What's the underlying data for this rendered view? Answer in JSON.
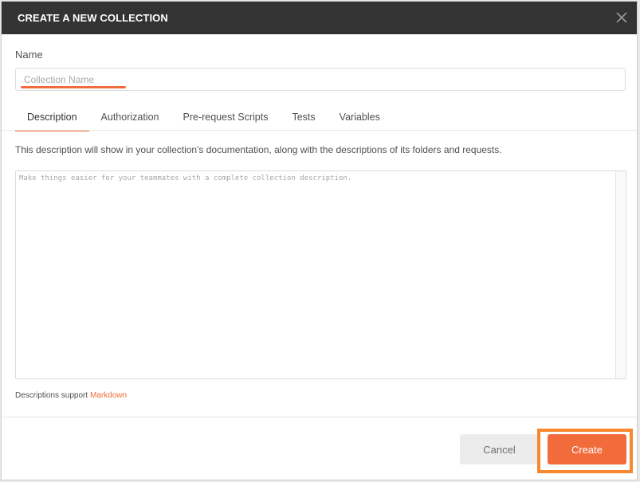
{
  "dialog": {
    "title": "CREATE A NEW COLLECTION"
  },
  "name": {
    "label": "Name",
    "placeholder": "Collection Name",
    "value": ""
  },
  "tabs": [
    {
      "label": "Description",
      "active": true
    },
    {
      "label": "Authorization",
      "active": false
    },
    {
      "label": "Pre-request Scripts",
      "active": false
    },
    {
      "label": "Tests",
      "active": false
    },
    {
      "label": "Variables",
      "active": false
    }
  ],
  "description": {
    "help_text": "This description will show in your collection's documentation, along with the descriptions of its folders and requests.",
    "placeholder": "Make things easier for your teammates with a complete collection description.",
    "markdown_note": "Descriptions support",
    "markdown_link": "Markdown"
  },
  "footer": {
    "cancel_label": "Cancel",
    "create_label": "Create"
  },
  "colors": {
    "accent": "#f26b3a",
    "header_bg": "#333333",
    "highlight": "#f7882f"
  },
  "icons": {
    "close": "close-icon"
  }
}
